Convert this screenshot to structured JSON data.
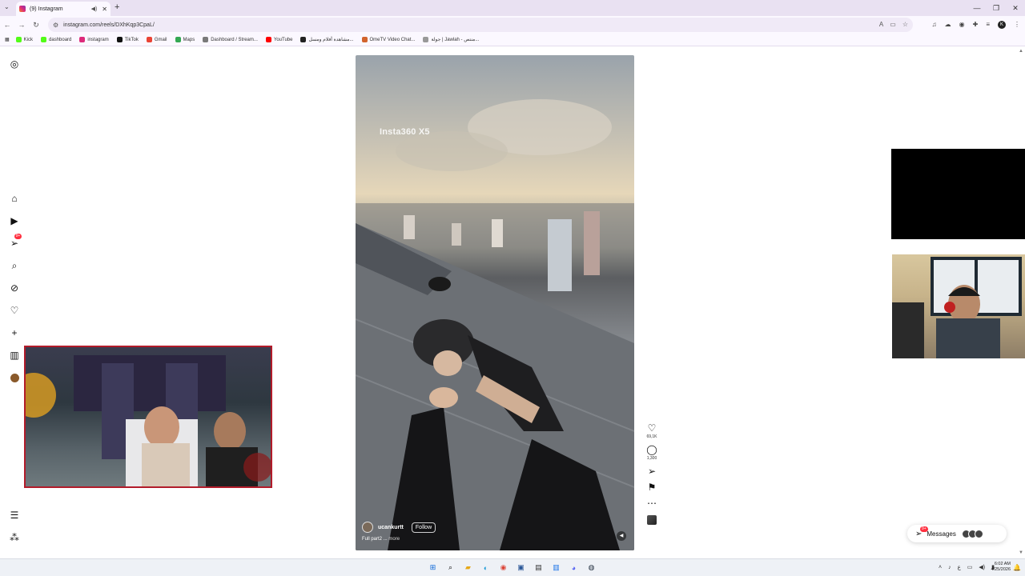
{
  "browser": {
    "tab_title": "(9) Instagram",
    "url": "instagram.com/reels/DXhKqp3CpaL/",
    "bookmarks": [
      {
        "label": "Kick",
        "color": "#53fc18"
      },
      {
        "label": "dashboard",
        "color": "#53fc18"
      },
      {
        "label": "instagram",
        "color": "#dd2a7b"
      },
      {
        "label": "TikTok",
        "color": "#111111"
      },
      {
        "label": "Gmail",
        "color": "#ea4335"
      },
      {
        "label": "Maps",
        "color": "#34a853"
      },
      {
        "label": "Dashboard / Stream...",
        "color": "#7a7a7a"
      },
      {
        "label": "YouTube",
        "color": "#ff0000"
      },
      {
        "label": "مشاهدة أفلام ومسل...",
        "color": "#222222"
      },
      {
        "label": "OmeTV Video Chat...",
        "color": "#d2642d"
      },
      {
        "label": "جولة | Jawlah - منتص...",
        "color": "#999999"
      }
    ]
  },
  "reel": {
    "watermark": "Insta360 X5",
    "username": "ucankurtt",
    "follow_label": "Follow",
    "caption": "Full part2 ...",
    "caption_more": "more"
  },
  "actions": {
    "likes": "69,1K",
    "comments": "1,300"
  },
  "sidebar": {
    "notifications_badge": "9+"
  },
  "messages": {
    "label": "Messages",
    "badge": "9+"
  },
  "taskbar": {
    "time": "6:02 AM",
    "date": "4/25/2026"
  },
  "colors": {
    "accent_red": "#ff3040",
    "cam_border": "#b21b2a"
  }
}
